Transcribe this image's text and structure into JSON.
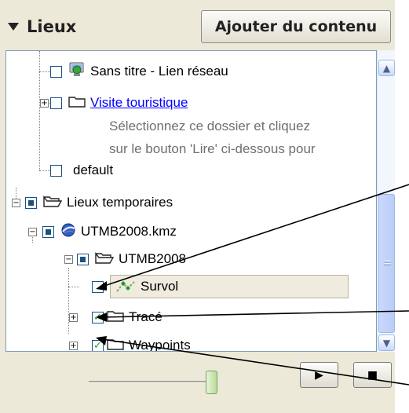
{
  "header": {
    "places_tab_label": "Lieux",
    "add_content_label": "Ajouter du contenu"
  },
  "tree": {
    "items": [
      {
        "label": "Sans titre - Lien réseau",
        "checked": false
      },
      {
        "label": "Visite touristique",
        "checked": false,
        "is_link": true
      },
      {
        "label": "default",
        "checked": false
      },
      {
        "label": "Lieux temporaires",
        "checked": "partial"
      },
      {
        "label": "UTMB2008.kmz",
        "checked": "partial"
      },
      {
        "label": "UTMB2008",
        "checked": "partial"
      },
      {
        "label": "Survol",
        "checked": false,
        "selected": true
      },
      {
        "label": "Tracé",
        "checked": true
      },
      {
        "label": "Waypoints",
        "checked": true
      }
    ],
    "description_line1": "Sélectionnez ce dossier et cliquez",
    "description_line2": "sur le bouton 'Lire' ci-dessous pour"
  },
  "icons": {
    "tree_expand": "plus-box",
    "tree_collapse": "minus-box",
    "checkbox_check": "✓"
  },
  "colors": {
    "panel_bg": "#ece9d8",
    "link": "#0000ff",
    "description": "#6f6f6f",
    "scroll_thumb": "#c9d8fb",
    "slider_thumb": "#b7dc98",
    "check_green": "#21a121"
  },
  "playback": {
    "slider_fraction": 0.95
  }
}
